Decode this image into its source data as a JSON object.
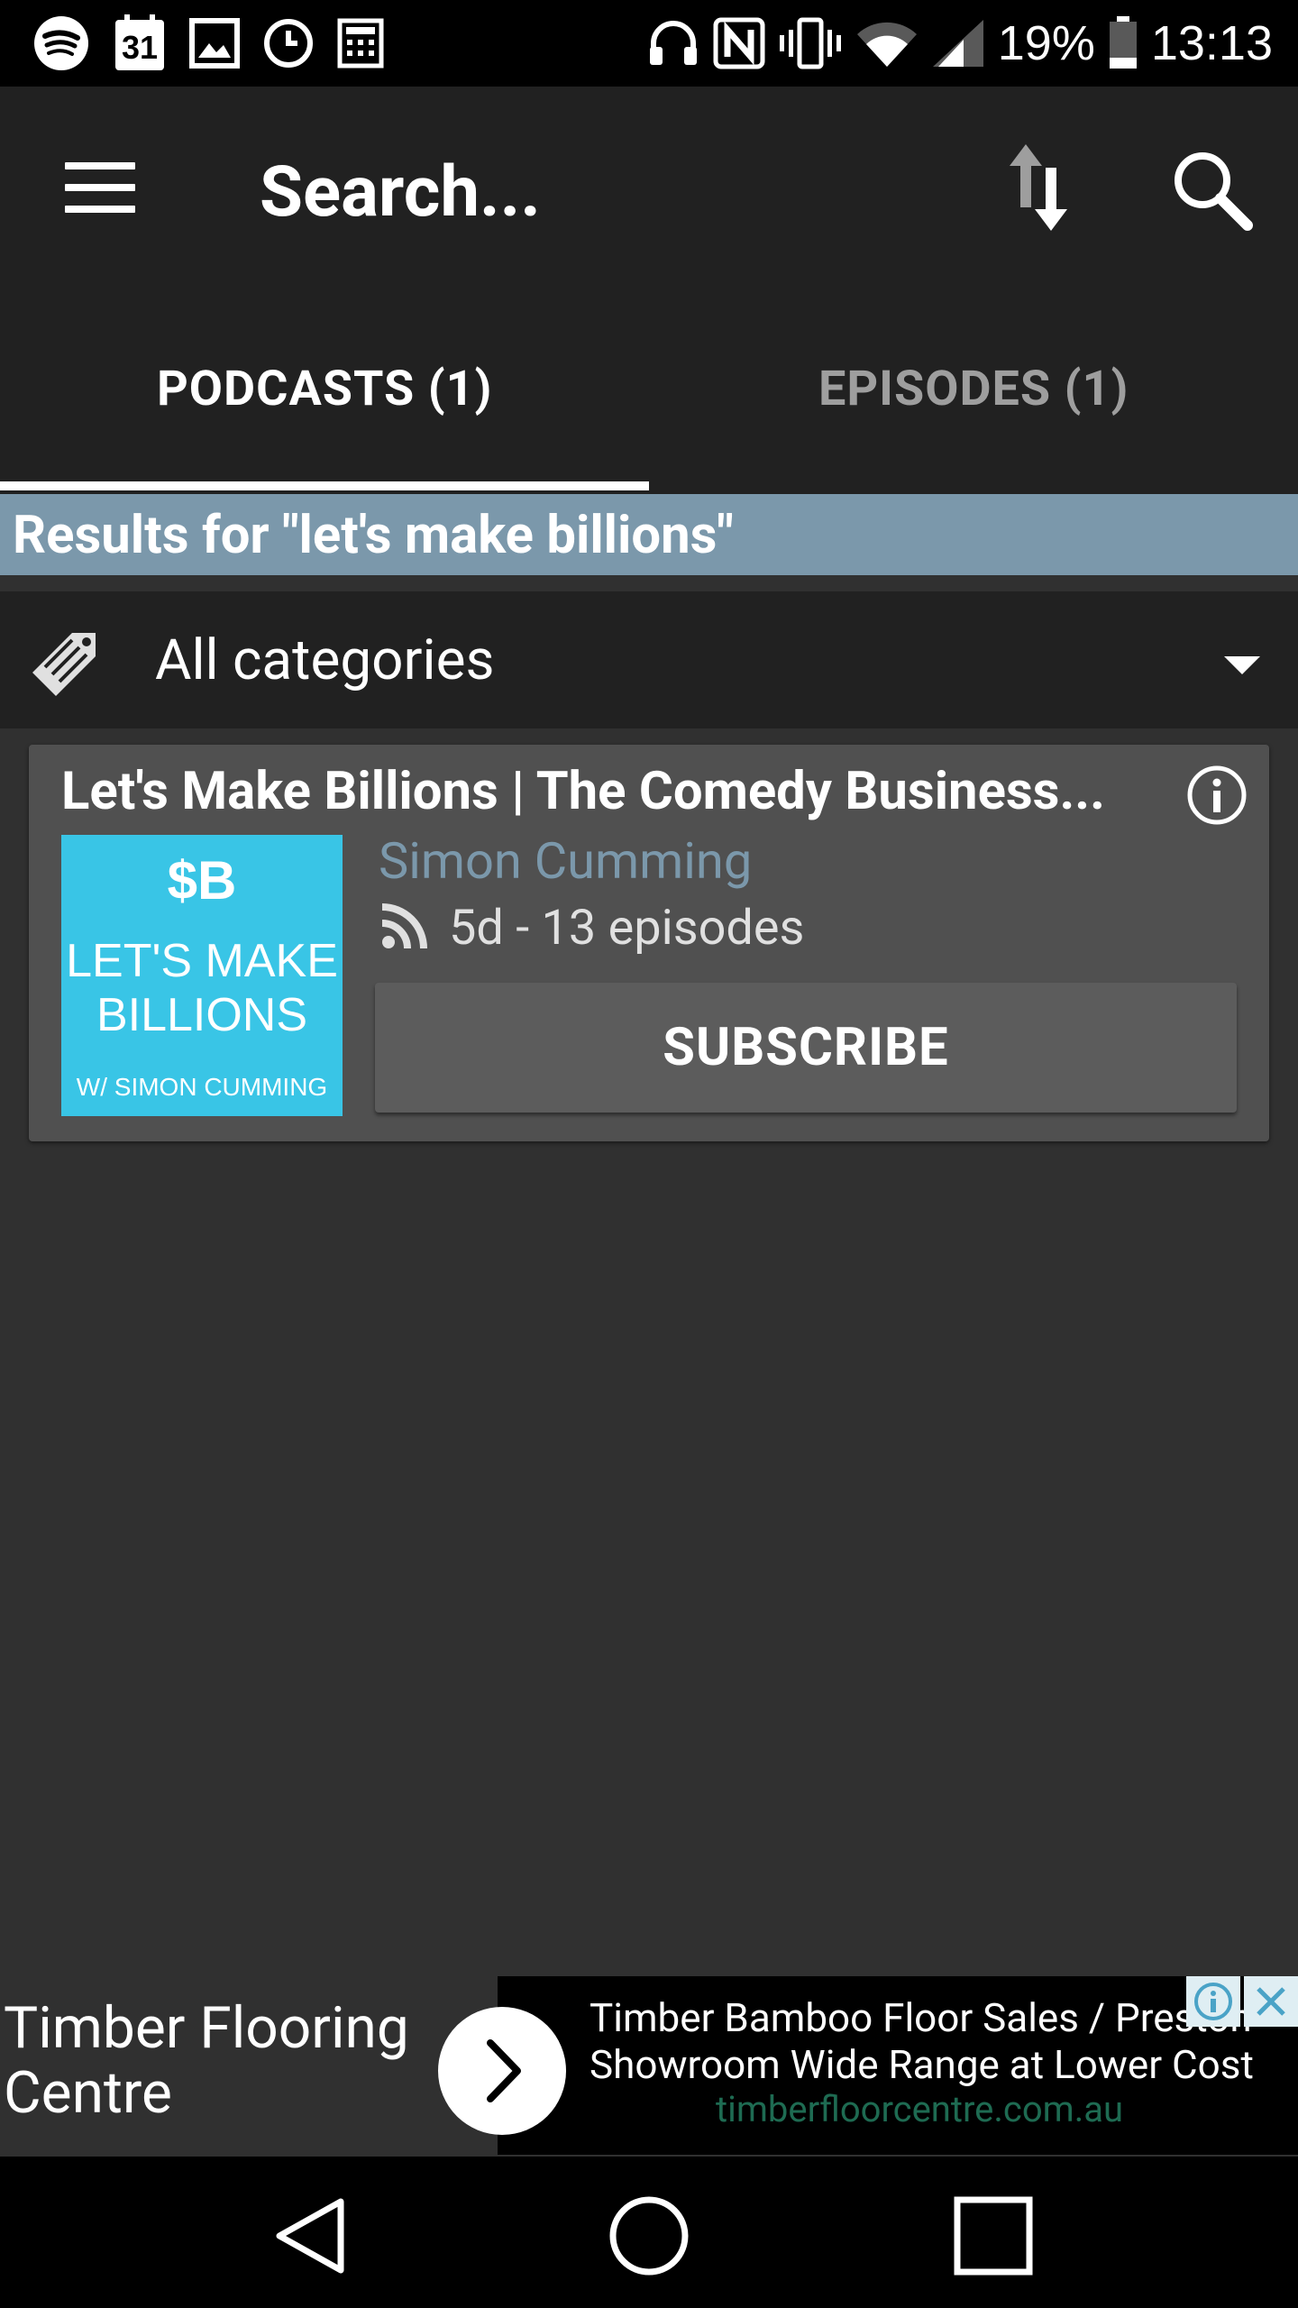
{
  "status_bar": {
    "battery": "19%",
    "time": "13:13",
    "calendar_day": "31",
    "left_icons": [
      "spotify-icon",
      "calendar-icon",
      "gallery-icon",
      "clock-icon",
      "calculator-icon"
    ],
    "right_icons": [
      "headphones-icon",
      "nfc-icon",
      "vibrate-icon",
      "wifi-icon",
      "signal-icon",
      "battery-icon"
    ]
  },
  "toolbar": {
    "title": "Search...",
    "icons": [
      "menu-icon",
      "sort-icon",
      "search-icon"
    ]
  },
  "tabs": [
    {
      "label": "PODCASTS (1)",
      "active": true
    },
    {
      "label": "EPISODES (1)",
      "active": false
    }
  ],
  "results": {
    "text": "Results for \"let's make billions\"",
    "banner_color": "#7b98ab"
  },
  "category": {
    "label": "All categories",
    "icon": "tag-icon"
  },
  "podcast": {
    "title": "Let's Make Billions | The Comedy Business...",
    "author": "Simon Cumming",
    "meta": "5d - 13 episodes",
    "subscribe_label": "SUBSCRIBE",
    "artwork": {
      "line1": "$B",
      "line2": "LET'S MAKE",
      "line3": "BILLIONS",
      "line4": "W/ SIMON CUMMING",
      "color": "#39c5e6"
    }
  },
  "ad": {
    "headline_1": "Timber Flooring",
    "headline_2": "Centre",
    "body_1": "Timber Bamboo Floor Sales / Preston",
    "body_2": "Showroom Wide Range at Lower Cost",
    "url": "timberfloorcentre.com.au"
  },
  "navbar": {
    "icons": [
      "back-icon",
      "home-icon",
      "recents-icon"
    ]
  }
}
